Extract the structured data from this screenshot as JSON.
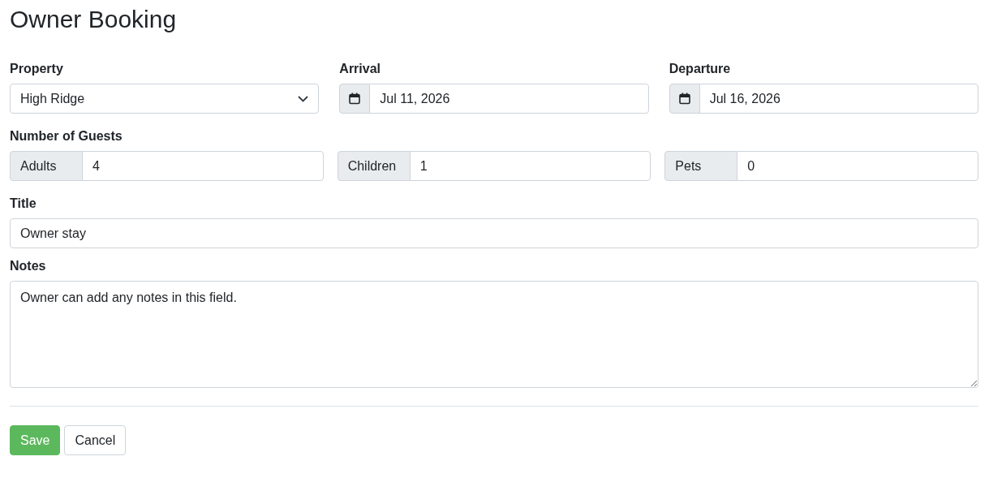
{
  "heading": "Owner Booking",
  "property": {
    "label": "Property",
    "value": "High Ridge"
  },
  "arrival": {
    "label": "Arrival",
    "value": "Jul 11, 2026"
  },
  "departure": {
    "label": "Departure",
    "value": "Jul 16, 2026"
  },
  "guests": {
    "label": "Number of Guests",
    "fields": [
      {
        "label": "Adults",
        "value": "4"
      },
      {
        "label": "Children",
        "value": "1"
      },
      {
        "label": "Pets",
        "value": "0"
      }
    ]
  },
  "title_field": {
    "label": "Title",
    "value": "Owner stay"
  },
  "notes": {
    "label": "Notes",
    "value": "Owner can add any notes in this field."
  },
  "buttons": [
    {
      "label": "Save",
      "kind": "primary"
    },
    {
      "label": "Cancel",
      "kind": "secondary"
    }
  ]
}
